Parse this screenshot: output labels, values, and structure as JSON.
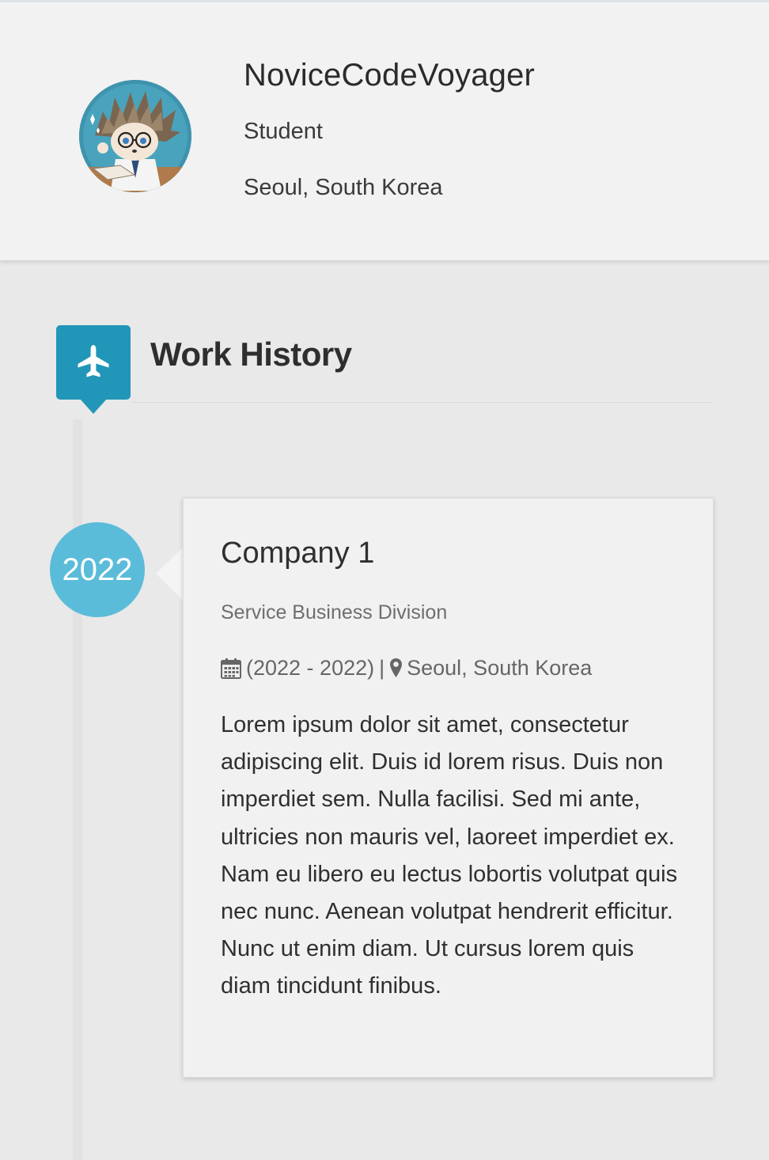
{
  "profile": {
    "name": "NoviceCodeVoyager",
    "role": "Student",
    "location": "Seoul, South Korea",
    "avatar_icon": "hedgehog-avatar"
  },
  "section": {
    "title": "Work History",
    "icon": "airplane-icon",
    "accent_color": "#2196b8"
  },
  "timeline": [
    {
      "year": "2022",
      "badge_color": "#5bbcd9",
      "company": "Company 1",
      "division": "Service Business Division",
      "date_range": "(2022 - 2022)",
      "separator": "|",
      "location": "Seoul, South Korea",
      "description": "Lorem ipsum dolor sit amet, consectetur adipiscing elit. Duis id lorem risus. Duis non imperdiet sem. Nulla facilisi. Sed mi ante, ultricies non mauris vel, laoreet imperdiet ex. Nam eu libero eu lectus lobortis volutpat quis nec nunc. Aenean volutpat hendrerit efficitur. Nunc ut enim diam. Ut cursus lorem quis diam tincidunt finibus."
    }
  ]
}
